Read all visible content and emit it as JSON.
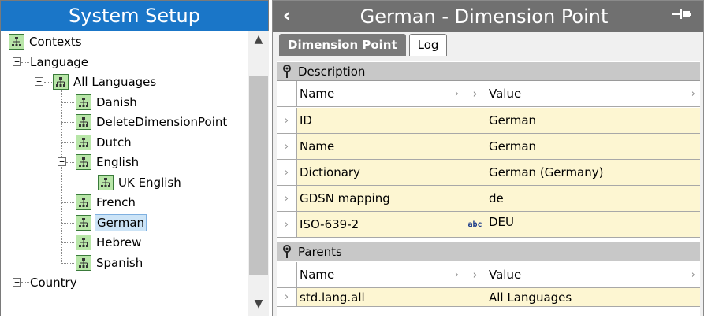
{
  "left": {
    "title": "System Setup",
    "tree": [
      {
        "label": "Contexts",
        "icon": "hierarchy-icon"
      },
      {
        "label": "Language",
        "expander": "−"
      },
      {
        "label": "All Languages",
        "icon": "hierarchy-icon",
        "expander": "−"
      },
      {
        "label": "Danish",
        "icon": "hierarchy-icon"
      },
      {
        "label": "DeleteDimensionPoint",
        "icon": "hierarchy-icon"
      },
      {
        "label": "Dutch",
        "icon": "hierarchy-icon"
      },
      {
        "label": "English",
        "icon": "hierarchy-icon",
        "expander": "−"
      },
      {
        "label": "UK English",
        "icon": "hierarchy-icon"
      },
      {
        "label": "French",
        "icon": "hierarchy-icon"
      },
      {
        "label": "German",
        "icon": "hierarchy-icon",
        "selected": true
      },
      {
        "label": "Hebrew",
        "icon": "hierarchy-icon"
      },
      {
        "label": "Spanish",
        "icon": "hierarchy-icon"
      },
      {
        "label": "Country",
        "expander": "+"
      }
    ],
    "scroll_up": "▲",
    "scroll_down": "▼"
  },
  "right": {
    "back_glyph": "‹",
    "title": "German - Dimension Point",
    "pin_glyph": "⊣▪",
    "tabs": [
      {
        "label_first": "D",
        "label_rest": "imension Point",
        "active": true
      },
      {
        "label_first": "L",
        "label_rest": "og",
        "active": false
      }
    ],
    "description": {
      "title": "Description",
      "header": {
        "name": "Name",
        "value": "Value"
      },
      "rows": [
        {
          "name": "ID",
          "type": "",
          "value": "German"
        },
        {
          "name": "Name",
          "type": "",
          "value": "German"
        },
        {
          "name": "Dictionary",
          "type": "",
          "value": "German (Germany)"
        },
        {
          "name": "GDSN mapping",
          "type": "",
          "value": "de"
        },
        {
          "name": "ISO-639-2",
          "type": "abc",
          "value": "DEU"
        }
      ]
    },
    "parents": {
      "title": "Parents",
      "header": {
        "name": "Name",
        "value": "Value"
      },
      "rows": [
        {
          "name": "std.lang.all",
          "type": "",
          "value": "All Languages"
        }
      ]
    },
    "row_arrow": "›",
    "colors": {
      "header_blue": "#1a76c8",
      "selection": "#cce4f7",
      "cell_yellow": "#fdf6d2",
      "dark_gray": "#707070"
    }
  }
}
